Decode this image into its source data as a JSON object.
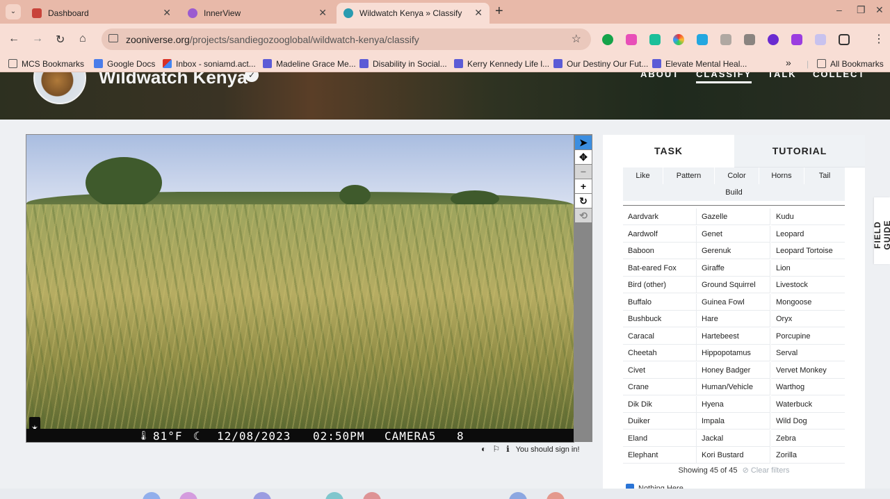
{
  "browser": {
    "tabs": [
      {
        "title": "Dashboard",
        "active": false
      },
      {
        "title": "InnerView",
        "active": false
      },
      {
        "title": "Wildwatch Kenya » Classify —",
        "active": true
      }
    ],
    "url_prefix": "zooniverse.org",
    "url_path": "/projects/sandiegozooglobal/wildwatch-kenya/classify",
    "bookmarks": [
      {
        "label": "MCS Bookmarks",
        "icon": "folder-icon"
      },
      {
        "label": "Google Docs",
        "icon": "docs-icon"
      },
      {
        "label": "Inbox - soniamd.act...",
        "icon": "gmail-icon"
      },
      {
        "label": "Madeline Grace Me...",
        "icon": "grid-icon"
      },
      {
        "label": "Disability in Social...",
        "icon": "grid-icon"
      },
      {
        "label": "Kerry Kennedy Life l...",
        "icon": "grid-icon"
      },
      {
        "label": "Our Destiny Our Fut...",
        "icon": "grid-icon"
      },
      {
        "label": "Elevate Mental Heal...",
        "icon": "grid-icon"
      }
    ],
    "overflow": "»",
    "all_bookmarks": "All Bookmarks"
  },
  "project": {
    "title": "Wildwatch Kenya",
    "nav": {
      "about": "ABOUT",
      "classify": "CLASSIFY",
      "talk": "TALK",
      "collect": "COLLECT"
    }
  },
  "subject": {
    "temperature": "81°F",
    "date": "12/08/2023",
    "time": "02:50PM",
    "camera": "CAMERA5",
    "frame": "8"
  },
  "viewer_tools": [
    "pointer-icon",
    "move-icon",
    "zoom-out-icon",
    "zoom-in-icon",
    "rotate-icon",
    "reset-icon"
  ],
  "sign_in_note": "You should sign in!",
  "task": {
    "tab_task": "TASK",
    "tab_tutorial": "TUTORIAL",
    "filters": [
      "Like",
      "Pattern",
      "Color",
      "Horns",
      "Tail",
      "Build"
    ],
    "species": [
      "Aardvark",
      "Gazelle",
      "Kudu",
      "Aardwolf",
      "Genet",
      "Leopard",
      "Baboon",
      "Gerenuk",
      "Leopard Tortoise",
      "Bat-eared Fox",
      "Giraffe",
      "Lion",
      "Bird (other)",
      "Ground Squirrel",
      "Livestock",
      "Buffalo",
      "Guinea Fowl",
      "Mongoose",
      "Bushbuck",
      "Hare",
      "Oryx",
      "Caracal",
      "Hartebeest",
      "Porcupine",
      "Cheetah",
      "Hippopotamus",
      "Serval",
      "Civet",
      "Honey Badger",
      "Vervet Monkey",
      "Crane",
      "Human/Vehicle",
      "Warthog",
      "Dik Dik",
      "Hyena",
      "Waterbuck",
      "Duiker",
      "Impala",
      "Wild Dog",
      "Eland",
      "Jackal",
      "Zebra",
      "Elephant",
      "Kori Bustard",
      "Zorilla"
    ],
    "showing": "Showing 45 of 45",
    "clear_filters": "Clear filters",
    "nothing_here": "Nothing Here"
  },
  "field_guide": "FIELD GUIDE"
}
